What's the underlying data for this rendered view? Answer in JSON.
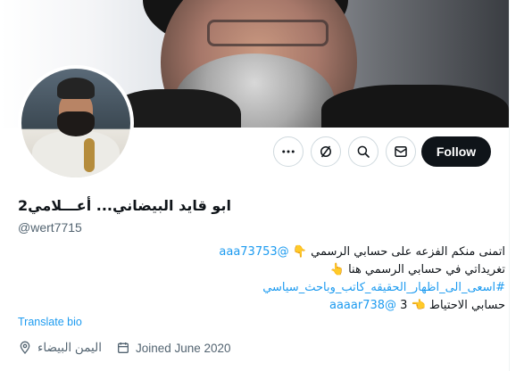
{
  "profile": {
    "display_name": "ابو قايد البيضاني... أعـــلامي2",
    "handle": "@wert7715",
    "follow_label": "Follow",
    "translate_label": "Translate bio",
    "location": "اليمن البيضاء",
    "joined": "Joined June 2020"
  },
  "bio": {
    "line1_text": "اتمنى منكم الفزعه على حسابي الرسمي",
    "line1_emoji": "👇",
    "line1_link": "@aaa73753",
    "line2_text": "تغريداتي في حسابي الرسمي هنا",
    "line2_emoji": "👆",
    "line3_hashtag": "#اسعى_الى_اظهار_الحقيقه_كاتب_وباحث_سياسي",
    "line4_text": "حسابي الاحتياط",
    "line4_emoji": "👈",
    "line4_num": "3",
    "line4_link": "@aaaar738"
  },
  "icons": {
    "more": "more-icon",
    "grok": "grok-icon",
    "search": "search-icon",
    "message": "message-icon",
    "location": "location-icon",
    "calendar": "calendar-icon"
  },
  "colors": {
    "accent": "#1d9bf0",
    "follow_bg": "#0f1419",
    "secondary_text": "#536471"
  }
}
